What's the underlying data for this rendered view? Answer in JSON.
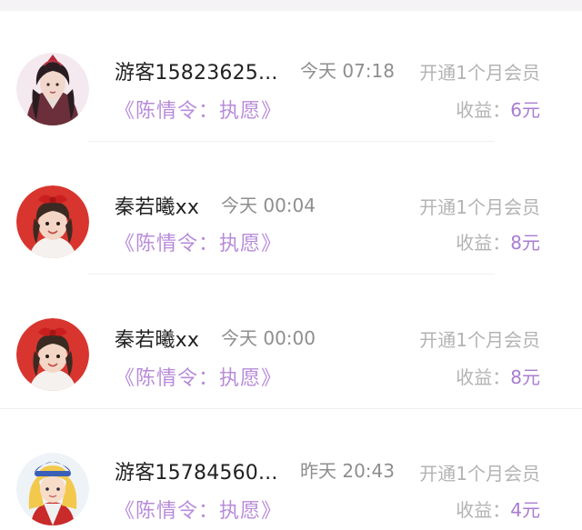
{
  "colors": {
    "accent": "#a97cd1",
    "title": "#b78bd9",
    "muted": "#b3b3b3",
    "time": "#8e8e8e",
    "text": "#222222"
  },
  "rows": [
    {
      "avatar": "avatar-ancient-costume-icon",
      "name": "游客15823625...",
      "time": "今天 07:18",
      "action": "开通1个月会员",
      "title": "《陈情令：执愿》",
      "earn_label": "收益：",
      "earn_value": "6元"
    },
    {
      "avatar": "avatar-child-red-bow-icon",
      "name": "秦若曦xx",
      "time": "今天 00:04",
      "action": "开通1个月会员",
      "title": "《陈情令：执愿》",
      "earn_label": "收益：",
      "earn_value": "8元"
    },
    {
      "avatar": "avatar-child-red-bow-icon",
      "name": "秦若曦xx",
      "time": "今天 00:00",
      "action": "开通1个月会员",
      "title": "《陈情令：执愿》",
      "earn_label": "收益：",
      "earn_value": "8元"
    },
    {
      "avatar": "avatar-blonde-cartoon-icon",
      "name": "游客15784560...",
      "time": "昨天 20:43",
      "action": "开通1个月会员",
      "title": "《陈情令：执愿》",
      "earn_label": "收益：",
      "earn_value": "4元"
    }
  ]
}
